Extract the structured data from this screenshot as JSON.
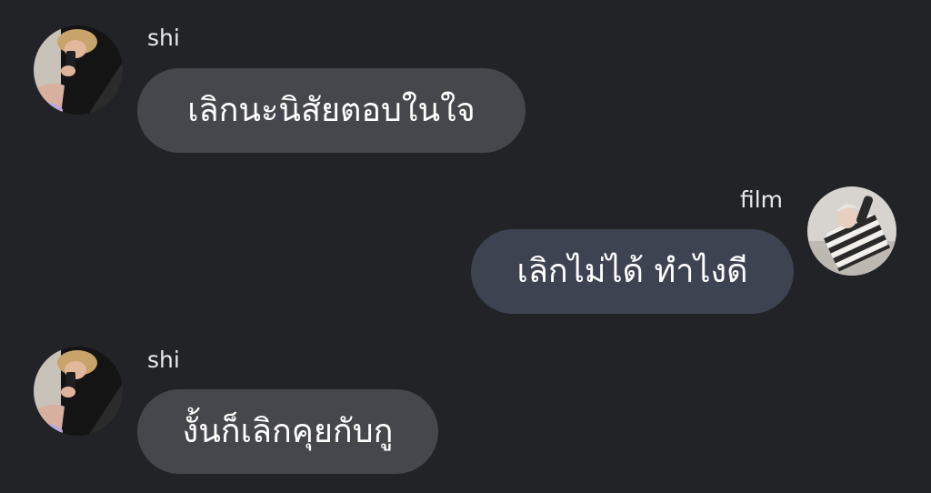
{
  "messages": [
    {
      "sender": "shi",
      "text": "เลิกนะนิสัยตอบในใจ",
      "direction": "incoming"
    },
    {
      "sender": "film",
      "text": "เลิกไม่ได้ ทำไงดี",
      "direction": "outgoing"
    },
    {
      "sender": "shi",
      "text": "งั้นก็เลิกคุยกับกู",
      "direction": "incoming"
    }
  ],
  "colors": {
    "background": "#222327",
    "incoming_bubble": "#46474c",
    "outgoing_bubble": "#3e4352",
    "text": "#ffffff"
  }
}
